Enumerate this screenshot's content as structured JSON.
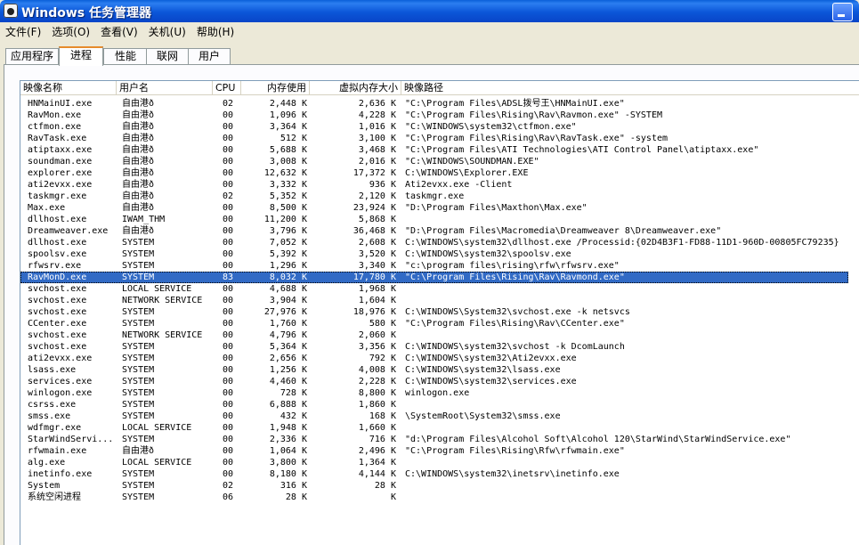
{
  "window": {
    "title": "Windows 任务管理器"
  },
  "menu": [
    "文件(F)",
    "选项(O)",
    "查看(V)",
    "关机(U)",
    "帮助(H)"
  ],
  "tabs": [
    {
      "label": "应用程序"
    },
    {
      "label": "进程",
      "active": true
    },
    {
      "label": "性能"
    },
    {
      "label": "联网"
    },
    {
      "label": "用户"
    }
  ],
  "columns": [
    "映像名称",
    "用户名",
    "CPU",
    "内存使用",
    "虚拟内存大小",
    "映像路径"
  ],
  "processes": [
    {
      "name": "HNMainUI.exe",
      "user": "自由港ð",
      "cpu": "02",
      "mem": "2,448 K",
      "vm": "2,636 K",
      "path": "\"C:\\Program Files\\ADSL拨号王\\HNMainUI.exe\""
    },
    {
      "name": "RavMon.exe",
      "user": "自由港ð",
      "cpu": "00",
      "mem": "1,096 K",
      "vm": "4,228 K",
      "path": "\"C:\\Program Files\\Rising\\Rav\\Ravmon.exe\" -SYSTEM"
    },
    {
      "name": "ctfmon.exe",
      "user": "自由港ð",
      "cpu": "00",
      "mem": "3,364 K",
      "vm": "1,016 K",
      "path": "\"C:\\WINDOWS\\system32\\ctfmon.exe\""
    },
    {
      "name": "RavTask.exe",
      "user": "自由港ð",
      "cpu": "00",
      "mem": "512 K",
      "vm": "3,100 K",
      "path": "\"C:\\Program Files\\Rising\\Rav\\RavTask.exe\" -system"
    },
    {
      "name": "atiptaxx.exe",
      "user": "自由港ð",
      "cpu": "00",
      "mem": "5,688 K",
      "vm": "3,468 K",
      "path": "\"C:\\Program Files\\ATI Technologies\\ATI Control Panel\\atiptaxx.exe\""
    },
    {
      "name": "soundman.exe",
      "user": "自由港ð",
      "cpu": "00",
      "mem": "3,008 K",
      "vm": "2,016 K",
      "path": "\"C:\\WINDOWS\\SOUNDMAN.EXE\""
    },
    {
      "name": "explorer.exe",
      "user": "自由港ð",
      "cpu": "00",
      "mem": "12,632 K",
      "vm": "17,372 K",
      "path": "C:\\WINDOWS\\Explorer.EXE"
    },
    {
      "name": "ati2evxx.exe",
      "user": "自由港ð",
      "cpu": "00",
      "mem": "3,332 K",
      "vm": "936 K",
      "path": "Ati2evxx.exe -Client"
    },
    {
      "name": "taskmgr.exe",
      "user": "自由港ð",
      "cpu": "02",
      "mem": "5,352 K",
      "vm": "2,120 K",
      "path": "taskmgr.exe"
    },
    {
      "name": "Max.exe",
      "user": "自由港ð",
      "cpu": "00",
      "mem": "8,500 K",
      "vm": "23,924 K",
      "path": "\"D:\\Program Files\\Maxthon\\Max.exe\""
    },
    {
      "name": "dllhost.exe",
      "user": "IWAM_THM",
      "cpu": "00",
      "mem": "11,200 K",
      "vm": "5,868 K",
      "path": ""
    },
    {
      "name": "Dreamweaver.exe",
      "user": "自由港ð",
      "cpu": "00",
      "mem": "3,796 K",
      "vm": "36,468 K",
      "path": "\"D:\\Program Files\\Macromedia\\Dreamweaver 8\\Dreamweaver.exe\""
    },
    {
      "name": "dllhost.exe",
      "user": "SYSTEM",
      "cpu": "00",
      "mem": "7,052 K",
      "vm": "2,608 K",
      "path": "C:\\WINDOWS\\system32\\dllhost.exe /Processid:{02D4B3F1-FD88-11D1-960D-00805FC79235}"
    },
    {
      "name": "spoolsv.exe",
      "user": "SYSTEM",
      "cpu": "00",
      "mem": "5,392 K",
      "vm": "3,520 K",
      "path": "C:\\WINDOWS\\system32\\spoolsv.exe"
    },
    {
      "name": "rfwsrv.exe",
      "user": "SYSTEM",
      "cpu": "00",
      "mem": "1,296 K",
      "vm": "3,340 K",
      "path": "\"c:\\program files\\rising\\rfw\\rfwsrv.exe\""
    },
    {
      "name": "RavMonD.exe",
      "user": "SYSTEM",
      "cpu": "83",
      "mem": "8,032 K",
      "vm": "17,780 K",
      "path": "\"C:\\Program Files\\Rising\\Rav\\Ravmond.exe\"",
      "selected": true
    },
    {
      "name": "svchost.exe",
      "user": "LOCAL SERVICE",
      "cpu": "00",
      "mem": "4,688 K",
      "vm": "1,968 K",
      "path": ""
    },
    {
      "name": "svchost.exe",
      "user": "NETWORK SERVICE",
      "cpu": "00",
      "mem": "3,904 K",
      "vm": "1,604 K",
      "path": ""
    },
    {
      "name": "svchost.exe",
      "user": "SYSTEM",
      "cpu": "00",
      "mem": "27,976 K",
      "vm": "18,976 K",
      "path": "C:\\WINDOWS\\System32\\svchost.exe -k netsvcs"
    },
    {
      "name": "CCenter.exe",
      "user": "SYSTEM",
      "cpu": "00",
      "mem": "1,760 K",
      "vm": "580 K",
      "path": "\"C:\\Program Files\\Rising\\Rav\\CCenter.exe\""
    },
    {
      "name": "svchost.exe",
      "user": "NETWORK SERVICE",
      "cpu": "00",
      "mem": "4,796 K",
      "vm": "2,060 K",
      "path": ""
    },
    {
      "name": "svchost.exe",
      "user": "SYSTEM",
      "cpu": "00",
      "mem": "5,364 K",
      "vm": "3,356 K",
      "path": "C:\\WINDOWS\\system32\\svchost -k DcomLaunch"
    },
    {
      "name": "ati2evxx.exe",
      "user": "SYSTEM",
      "cpu": "00",
      "mem": "2,656 K",
      "vm": "792 K",
      "path": "C:\\WINDOWS\\system32\\Ati2evxx.exe"
    },
    {
      "name": "lsass.exe",
      "user": "SYSTEM",
      "cpu": "00",
      "mem": "1,256 K",
      "vm": "4,008 K",
      "path": "C:\\WINDOWS\\system32\\lsass.exe"
    },
    {
      "name": "services.exe",
      "user": "SYSTEM",
      "cpu": "00",
      "mem": "4,460 K",
      "vm": "2,228 K",
      "path": "C:\\WINDOWS\\system32\\services.exe"
    },
    {
      "name": "winlogon.exe",
      "user": "SYSTEM",
      "cpu": "00",
      "mem": "728 K",
      "vm": "8,800 K",
      "path": "winlogon.exe"
    },
    {
      "name": "csrss.exe",
      "user": "SYSTEM",
      "cpu": "00",
      "mem": "6,888 K",
      "vm": "1,860 K",
      "path": ""
    },
    {
      "name": "smss.exe",
      "user": "SYSTEM",
      "cpu": "00",
      "mem": "432 K",
      "vm": "168 K",
      "path": "\\SystemRoot\\System32\\smss.exe"
    },
    {
      "name": "wdfmgr.exe",
      "user": "LOCAL SERVICE",
      "cpu": "00",
      "mem": "1,948 K",
      "vm": "1,660 K",
      "path": ""
    },
    {
      "name": "StarWindServi...",
      "user": "SYSTEM",
      "cpu": "00",
      "mem": "2,336 K",
      "vm": "716 K",
      "path": "\"d:\\Program Files\\Alcohol Soft\\Alcohol 120\\StarWind\\StarWindService.exe\""
    },
    {
      "name": "rfwmain.exe",
      "user": "自由港ð",
      "cpu": "00",
      "mem": "1,064 K",
      "vm": "2,496 K",
      "path": "\"C:\\Program Files\\Rising\\Rfw\\rfwmain.exe\""
    },
    {
      "name": "alg.exe",
      "user": "LOCAL SERVICE",
      "cpu": "00",
      "mem": "3,800 K",
      "vm": "1,364 K",
      "path": ""
    },
    {
      "name": "inetinfo.exe",
      "user": "SYSTEM",
      "cpu": "00",
      "mem": "8,180 K",
      "vm": "4,144 K",
      "path": "C:\\WINDOWS\\system32\\inetsrv\\inetinfo.exe"
    },
    {
      "name": "System",
      "user": "SYSTEM",
      "cpu": "02",
      "mem": "316 K",
      "vm": "28 K",
      "path": ""
    },
    {
      "name": "系统空闲进程",
      "user": "SYSTEM",
      "cpu": "06",
      "mem": "28 K",
      "vm": "K",
      "path": ""
    }
  ]
}
